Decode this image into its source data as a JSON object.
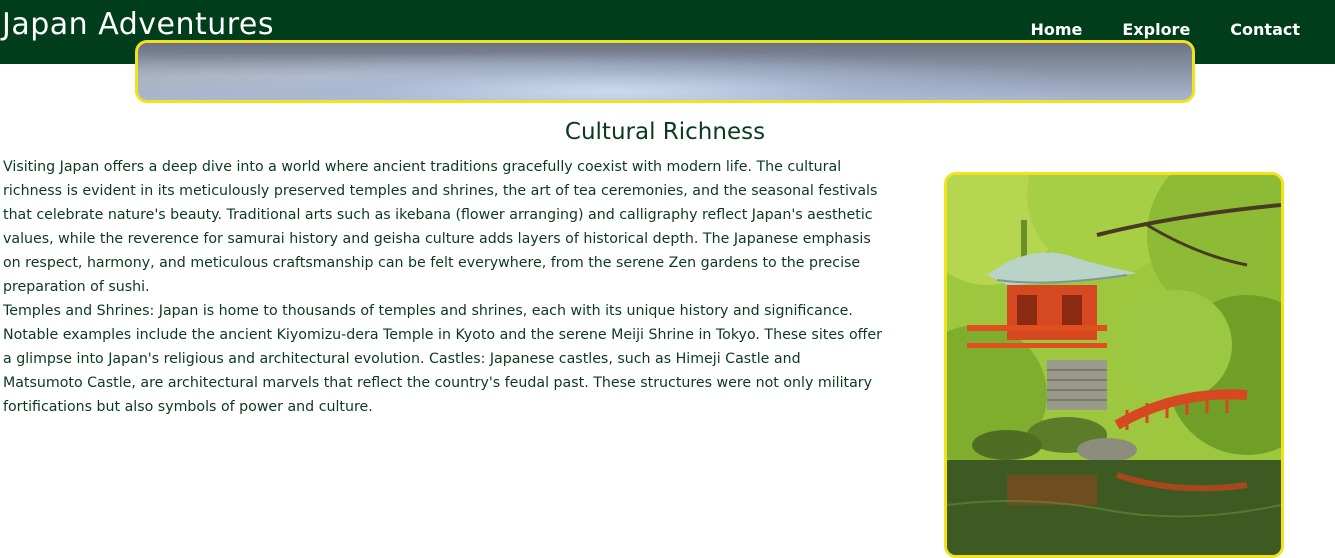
{
  "header": {
    "site_title": "Japan Adventures",
    "nav": [
      {
        "label": "Home"
      },
      {
        "label": "Explore"
      },
      {
        "label": "Contact"
      }
    ]
  },
  "section": {
    "title": "Cultural Richness",
    "paragraphs": [
      "Visiting Japan offers a deep dive into a world where ancient traditions gracefully coexist with modern life. The cultural richness is evident in its meticulously preserved temples and shrines, the art of tea ceremonies, and the seasonal festivals that celebrate nature's beauty. Traditional arts such as ikebana (flower arranging) and calligraphy reflect Japan's aesthetic values, while the reverence for samurai history and geisha culture adds layers of historical depth. The Japanese emphasis on respect, harmony, and meticulous craftsmanship can be felt everywhere, from the serene Zen gardens to the precise preparation of sushi.",
      "Temples and Shrines: Japan is home to thousands of temples and shrines, each with its unique history and significance. Notable examples include the ancient Kiyomizu-dera Temple in Kyoto and the serene Meiji Shrine in Tokyo. These sites offer a glimpse into Japan's religious and architectural evolution. Castles: Japanese castles, such as Himeji Castle and Matsumoto Castle, are architectural marvels that reflect the country's feudal past. These structures were not only military fortifications but also symbols of power and culture."
    ]
  },
  "colors": {
    "navbar_bg": "#003d1a",
    "text": "#0a3a1e",
    "image_border": "#f2e21b"
  },
  "images": {
    "hero": "cloudy-sky-banner",
    "side": "red-pagoda-garden-photo"
  }
}
